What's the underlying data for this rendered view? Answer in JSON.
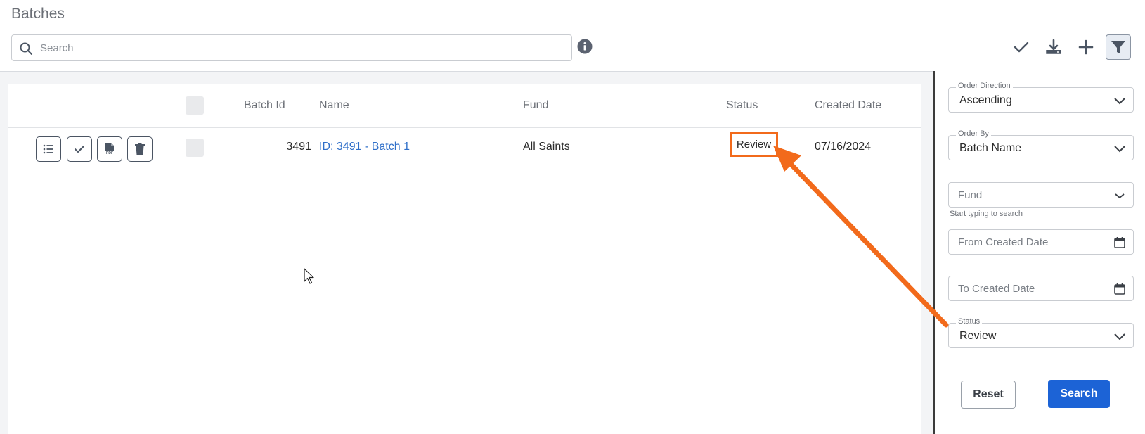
{
  "page": {
    "title": "Batches"
  },
  "search": {
    "placeholder": "Search",
    "value": ""
  },
  "toolbar": {
    "items": [
      {
        "icon": "checkmark-icon"
      },
      {
        "icon": "download-icon"
      },
      {
        "icon": "plus-icon"
      },
      {
        "icon": "filter-icon",
        "active": true
      }
    ]
  },
  "table": {
    "columns": {
      "batch_id": "Batch Id",
      "name": "Name",
      "fund": "Fund",
      "status": "Status",
      "created_date": "Created Date"
    },
    "rows": [
      {
        "batch_id": "3491",
        "name": "ID: 3491 - Batch 1",
        "fund": "All Saints",
        "status": "Review",
        "created_date": "07/16/2024",
        "actions": [
          "list-icon",
          "checkmark-icon",
          "pdf-icon",
          "trash-icon"
        ]
      }
    ]
  },
  "filters": {
    "order_direction": {
      "label": "Order Direction",
      "value": "Ascending"
    },
    "order_by": {
      "label": "Order By",
      "value": "Batch Name"
    },
    "fund": {
      "placeholder": "Fund",
      "hint": "Start typing to search"
    },
    "from_created_date": {
      "placeholder": "From Created Date"
    },
    "to_created_date": {
      "placeholder": "To Created Date"
    },
    "status": {
      "label": "Status",
      "value": "Review"
    },
    "reset_label": "Reset",
    "search_label": "Search"
  },
  "colors": {
    "accent": "#1c63d6",
    "link": "#2f6fc9",
    "annotation": "#f26a1b"
  }
}
